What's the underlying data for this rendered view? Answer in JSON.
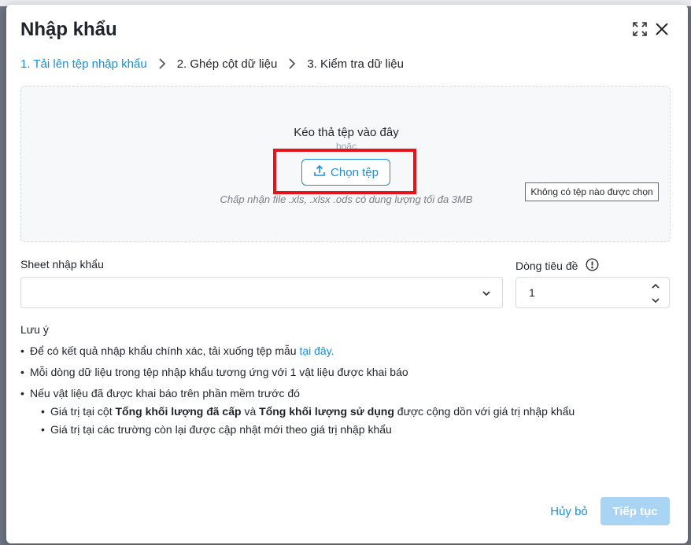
{
  "modal": {
    "title": "Nhập khẩu"
  },
  "steps": [
    {
      "label": "1. Tải lên tệp nhập khẩu",
      "active": true
    },
    {
      "label": "2. Ghép cột dữ liệu",
      "active": false
    },
    {
      "label": "3. Kiểm tra dữ liệu",
      "active": false
    }
  ],
  "dropzone": {
    "title": "Kéo thả tệp vào đây",
    "or": "hoặc",
    "button_label": "Chọn tệp",
    "note": "Chấp nhận file .xls, .xlsx .ods có dung lượng tối đa 3MB",
    "file_status": "Không có tệp nào được chọn"
  },
  "form": {
    "sheet_label": "Sheet nhập khẩu",
    "sheet_value": "",
    "header_row_label": "Dòng tiêu đề",
    "header_row_value": "1"
  },
  "notes": {
    "title": "Lưu ý",
    "item1_text": "Để có kết quả nhập khẩu chính xác, tải xuống tệp mẫu ",
    "item1_link": "tại đây.",
    "item2_text": "Mỗi dòng dữ liệu trong tệp nhập khẩu tương ứng với 1 vật liệu được khai báo",
    "item3_text": "Nếu vật liệu đã được khai báo trên phần mềm trước đó",
    "sub1_a": "Giá trị tại cột ",
    "sub1_b": "Tổng khối lượng đã cấp",
    "sub1_c": " và ",
    "sub1_d": "Tổng khối lượng sử dụng",
    "sub1_e": " được cộng dồn với giá trị nhập khẩu",
    "sub2_text": "Giá trị tại các trường còn lại được cập nhật mới theo giá trị nhập khẩu"
  },
  "footer": {
    "cancel_label": "Hủy bỏ",
    "next_label": "Tiếp tục"
  },
  "colors": {
    "accent": "#1a8fd9",
    "highlight": "#e8121b",
    "disabled": "#a9d4f3"
  },
  "icons": [
    "expand-icon",
    "close-icon",
    "chevron-right-icon",
    "upload-icon",
    "chevron-down-icon",
    "info-icon"
  ]
}
